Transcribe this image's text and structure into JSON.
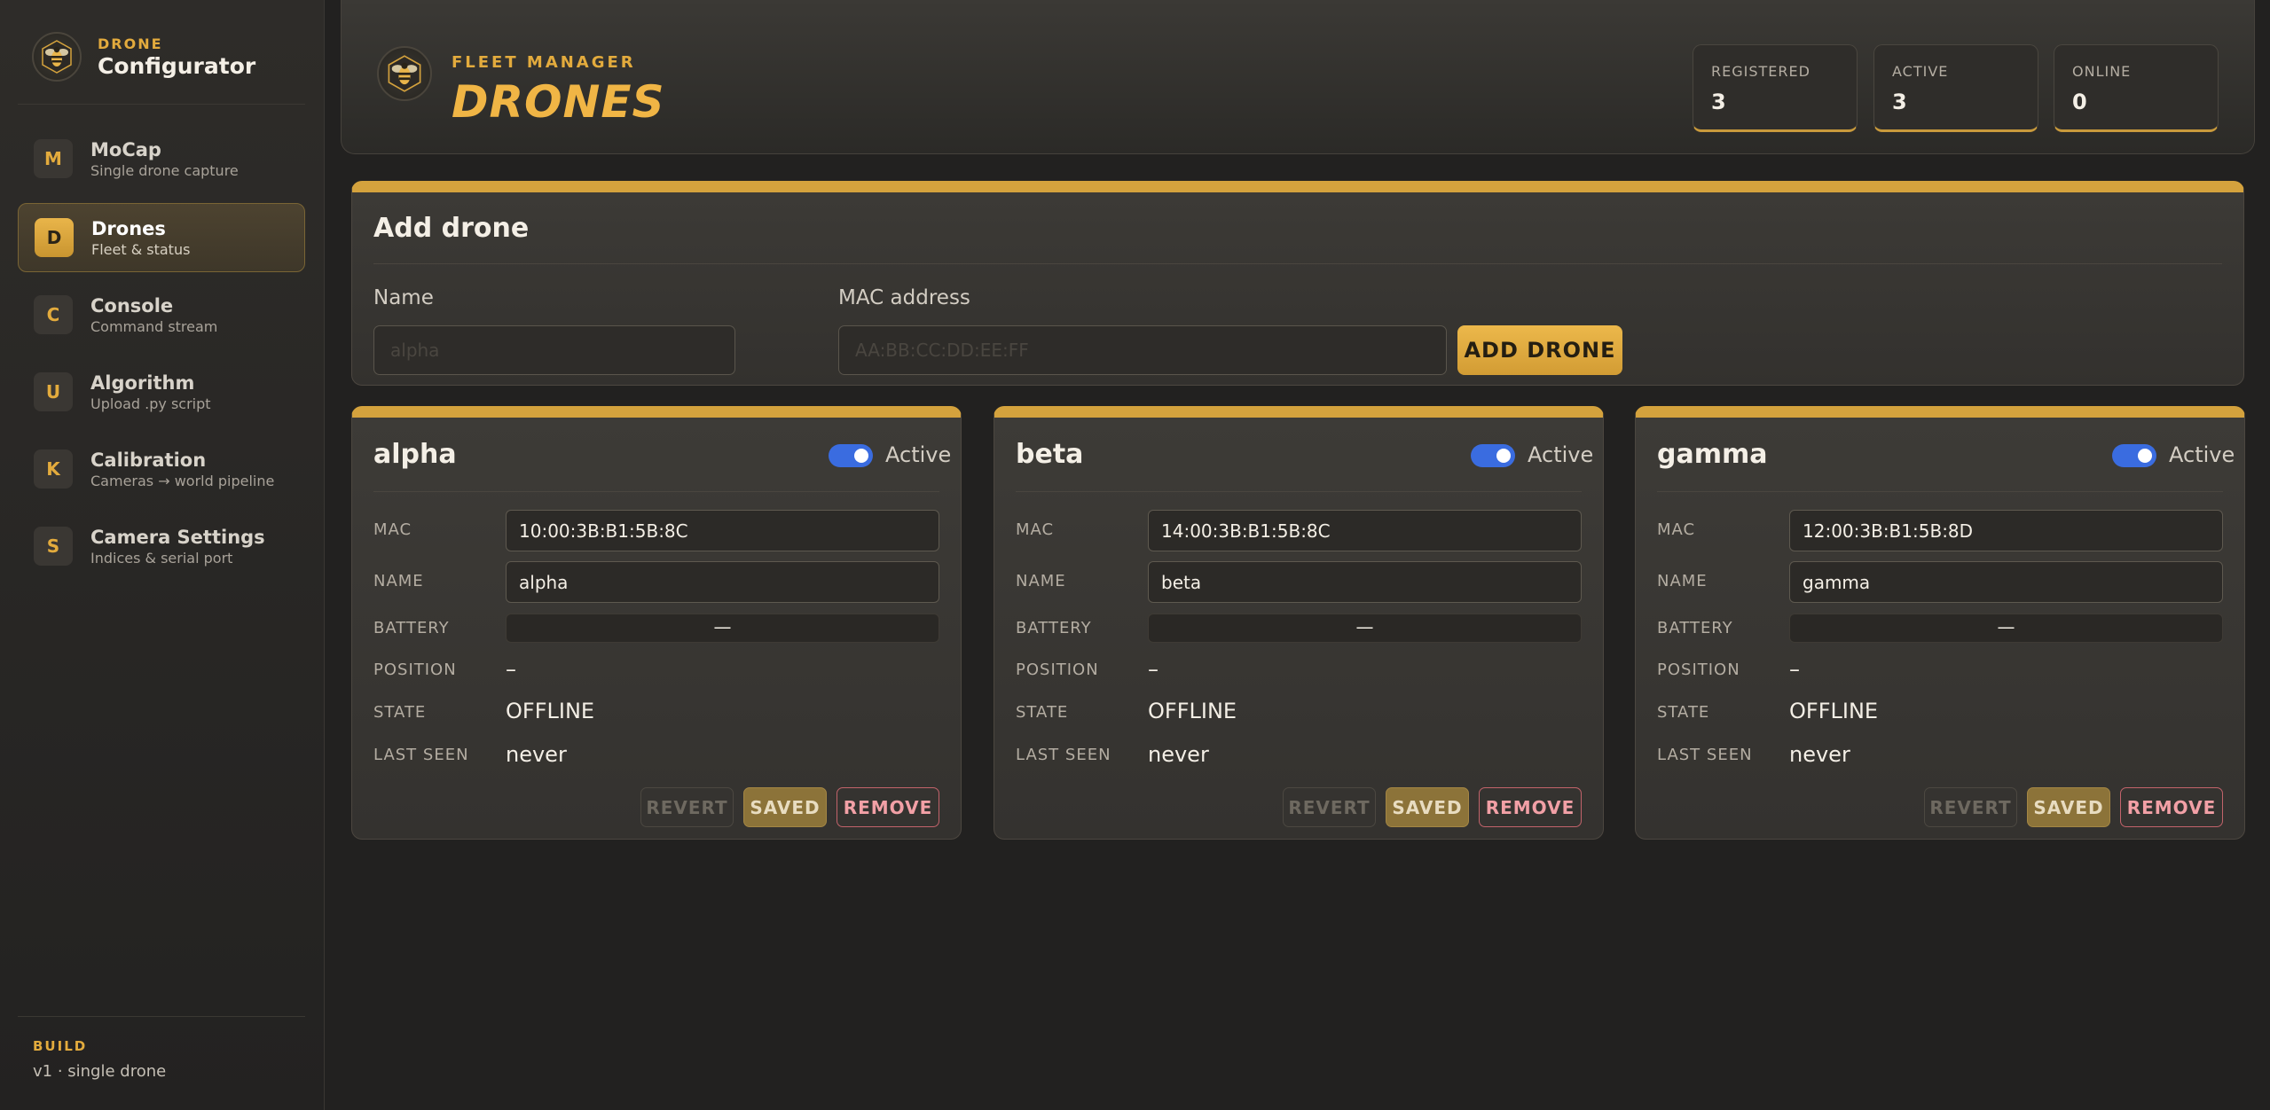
{
  "brand": {
    "eyebrow": "DRONE",
    "title": "Configurator"
  },
  "sidebar": {
    "items": [
      {
        "letter": "M",
        "title": "MoCap",
        "subtitle": "Single drone capture",
        "active": false
      },
      {
        "letter": "D",
        "title": "Drones",
        "subtitle": "Fleet & status",
        "active": true
      },
      {
        "letter": "C",
        "title": "Console",
        "subtitle": "Command stream",
        "active": false
      },
      {
        "letter": "U",
        "title": "Algorithm",
        "subtitle": "Upload .py script",
        "active": false
      },
      {
        "letter": "K",
        "title": "Calibration",
        "subtitle": "Cameras → world pipeline",
        "active": false
      },
      {
        "letter": "S",
        "title": "Camera Settings",
        "subtitle": "Indices & serial port",
        "active": false
      }
    ],
    "build": {
      "label": "BUILD",
      "value": "v1 · single drone"
    }
  },
  "header": {
    "eyebrow": "FLEET MANAGER",
    "title": "DRONES",
    "stats": [
      {
        "label": "REGISTERED",
        "value": "3"
      },
      {
        "label": "ACTIVE",
        "value": "3"
      },
      {
        "label": "ONLINE",
        "value": "0"
      }
    ]
  },
  "add_drone": {
    "title": "Add drone",
    "name_label": "Name",
    "name_placeholder": "alpha",
    "mac_label": "MAC address",
    "mac_placeholder": "AA:BB:CC:DD:EE:FF",
    "button_label": "ADD DRONE"
  },
  "labels": {
    "active": "Active",
    "mac": "MAC",
    "name": "NAME",
    "battery": "BATTERY",
    "position": "POSITION",
    "state": "STATE",
    "last_seen": "LAST SEEN",
    "revert": "REVERT",
    "saved": "SAVED",
    "remove": "REMOVE"
  },
  "drones": [
    {
      "title": "alpha",
      "active": true,
      "mac": "10:00:3B:B1:5B:8C",
      "name": "alpha",
      "battery": "—",
      "battery_level": 0,
      "position": "–",
      "state": "OFFLINE",
      "last_seen": "never"
    },
    {
      "title": "beta",
      "active": true,
      "mac": "14:00:3B:B1:5B:8C",
      "name": "beta",
      "battery": "—",
      "battery_level": 0,
      "position": "–",
      "state": "OFFLINE",
      "last_seen": "never"
    },
    {
      "title": "gamma",
      "active": true,
      "mac": "12:00:3B:B1:5B:8D",
      "name": "gamma",
      "battery": "—",
      "battery_level": 0,
      "position": "–",
      "state": "OFFLINE",
      "last_seen": "never"
    }
  ],
  "colors": {
    "accent": "#e3ab3d",
    "toggle_on": "#3a6ce0",
    "remove": "#f2a0a6",
    "background": "#222120"
  },
  "icons": {
    "logo": "bee-icon"
  }
}
